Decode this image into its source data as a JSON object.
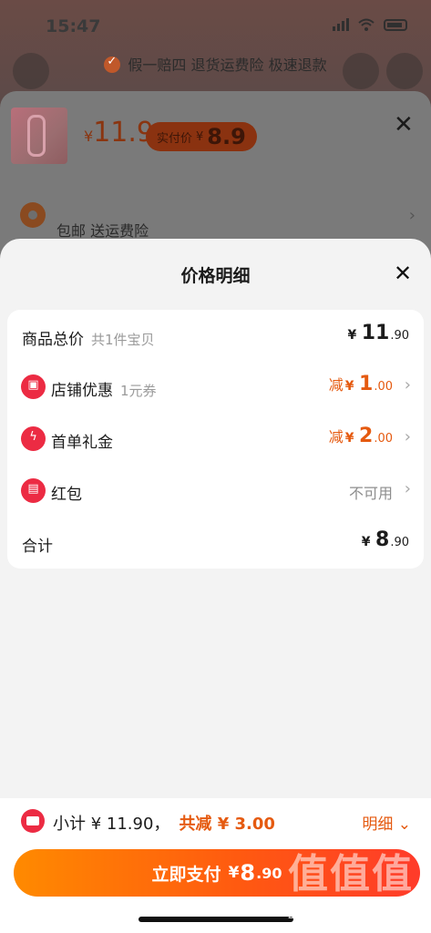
{
  "status_bar": {
    "time": "15:47"
  },
  "background": {
    "guarantee_text": "假一赔四 退货运费险 极速退款",
    "product": {
      "price_yen": "¥",
      "price": "11.9",
      "actual_label": "实付价",
      "actual_yen": "¥",
      "actual_price": "8.9"
    },
    "shipping": {
      "text": "包邮  送运费险"
    }
  },
  "sheet": {
    "title": "价格明细",
    "rows": [
      {
        "label": "商品总价",
        "sub": "共1件宝贝",
        "yen": "¥",
        "int": "11",
        "dec": ".90"
      },
      {
        "label": "店铺优惠",
        "sub": "1元券",
        "prefix": "减",
        "yen": "¥",
        "int": "1",
        "dec": ".00"
      },
      {
        "label": "首单礼金",
        "sub": "",
        "prefix": "减",
        "yen": "¥",
        "int": "2",
        "dec": ".00"
      },
      {
        "label": "红包",
        "sub": "",
        "status": "不可用"
      },
      {
        "label": "合计",
        "sub": "",
        "yen": "¥",
        "int": "8",
        "dec": ".90"
      }
    ]
  },
  "bottom": {
    "subtotal": "小计 ¥ 11.90，",
    "discount": "共减 ¥ 3.00",
    "detail_link": "明细",
    "pay_label": "立即支付",
    "pay_yen": "¥",
    "pay_int": "8",
    "pay_dec": ".90"
  },
  "watermark": {
    "glyphs": "值值值",
    "url": "zhizhizhi.com"
  },
  "colors": {
    "accent_orange": "#e55a10",
    "icon_red": "#ec2b43",
    "button_start": "#ff8a00",
    "button_end": "#ff3b2a"
  }
}
